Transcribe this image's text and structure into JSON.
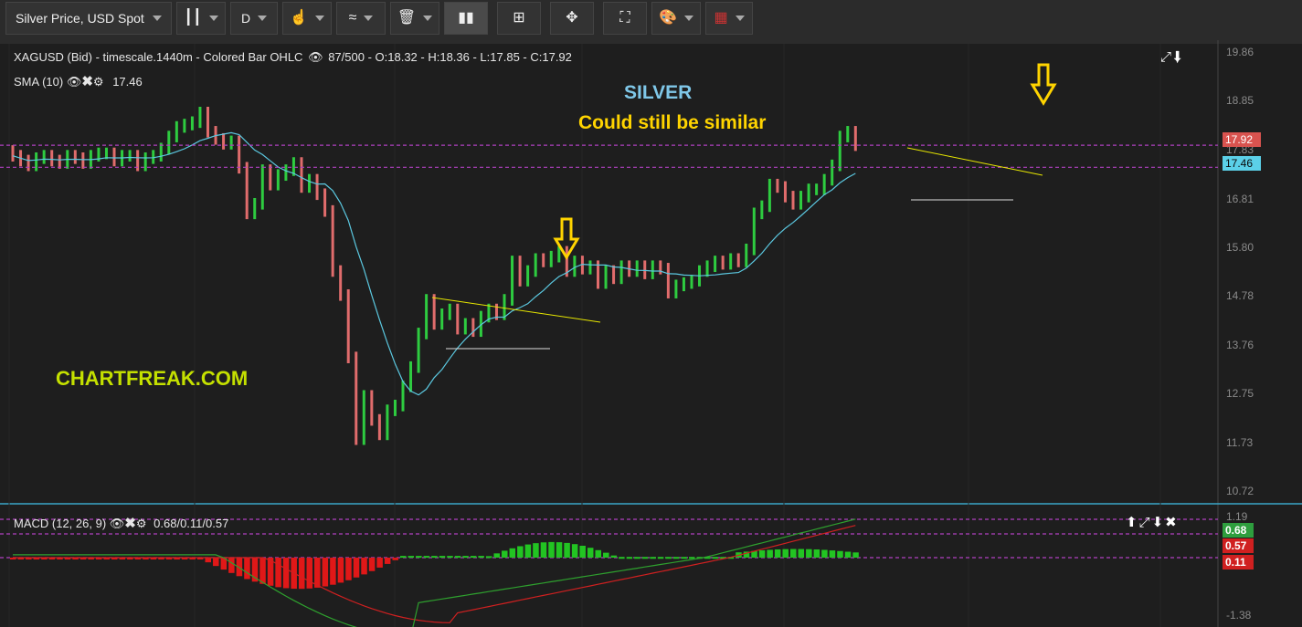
{
  "toolbar": {
    "symbol": "Silver Price, USD Spot",
    "timeframe": "D"
  },
  "main_pane": {
    "header": "XAGUSD (Bid) - timescale.1440m - Colored Bar OHLC",
    "bars": "87/500",
    "ohlc": "- O:18.32 - H:18.36 - L:17.85 - C:17.92",
    "sma_label": "SMA (10)",
    "sma_value": "17.46",
    "price_tag": "17.92",
    "sma_tag": "17.46",
    "y_ticks": [
      "19.86",
      "18.85",
      "17.83",
      "16.81",
      "15.80",
      "14.78",
      "13.76",
      "12.75",
      "11.73",
      "10.72"
    ]
  },
  "annotations": {
    "title": "SILVER",
    "subtitle": "Could still be similar",
    "watermark": "CHARTFREAK.COM"
  },
  "macd_pane": {
    "label": "MACD (12, 26, 9)",
    "values": "0.68/0.11/0.57",
    "tag_macd": "0.68",
    "tag_signal": "0.57",
    "tag_hist": "0.11",
    "y_top": "1.19",
    "y_bottom": "-1.38"
  },
  "colors": {
    "up": "#2ecc40",
    "down": "#e06c6c",
    "sma": "#5bc8e0",
    "annotation_yellow": "#ffd400",
    "title_blue": "#7fc7e8",
    "watermark_green": "#c4e000"
  },
  "chart_data": {
    "type": "ohlc",
    "series": [
      {
        "name": "XAGUSD",
        "closes": [
          17.7,
          17.6,
          17.5,
          17.65,
          17.7,
          17.6,
          17.55,
          17.7,
          17.65,
          17.55,
          17.7,
          17.75,
          17.75,
          17.6,
          17.7,
          17.7,
          17.5,
          17.65,
          17.7,
          17.85,
          18.1,
          18.3,
          18.35,
          18.4,
          18.6,
          18.2,
          18.05,
          17.95,
          18.0,
          17.45,
          16.5,
          16.7,
          17.4,
          17.1,
          17.3,
          17.4,
          17.55,
          17.05,
          17.2,
          16.9,
          16.55,
          15.3,
          14.8,
          13.5,
          11.8,
          12.7,
          12.2,
          11.9,
          12.4,
          12.5,
          12.9,
          13.3,
          14.0,
          14.7,
          14.2,
          14.4,
          14.5,
          14.1,
          14.2,
          14.05,
          14.35,
          14.5,
          14.4,
          14.7,
          15.5,
          15.1,
          15.3,
          15.55,
          15.5,
          15.6,
          15.7,
          15.3,
          15.5,
          15.35,
          15.4,
          15.05,
          15.3,
          15.15,
          15.4,
          15.3,
          15.4,
          15.25,
          15.4,
          15.35,
          14.85,
          15.0,
          15.05,
          15.1,
          15.3,
          15.4,
          15.5,
          15.45,
          15.55,
          15.5,
          15.75,
          16.5,
          16.65,
          17.1,
          17.05,
          16.85,
          16.7,
          16.85,
          17.0,
          17.0,
          17.2,
          17.5,
          18.1,
          18.2,
          17.92
        ]
      },
      {
        "name": "SMA (10)",
        "last": 17.46
      }
    ],
    "ylim": [
      10.72,
      19.86
    ],
    "levels": [
      17.92,
      17.46
    ],
    "macd": {
      "macd": 0.68,
      "signal": 0.57,
      "histogram": 0.11,
      "ylim": [
        -1.38,
        1.19
      ]
    }
  }
}
